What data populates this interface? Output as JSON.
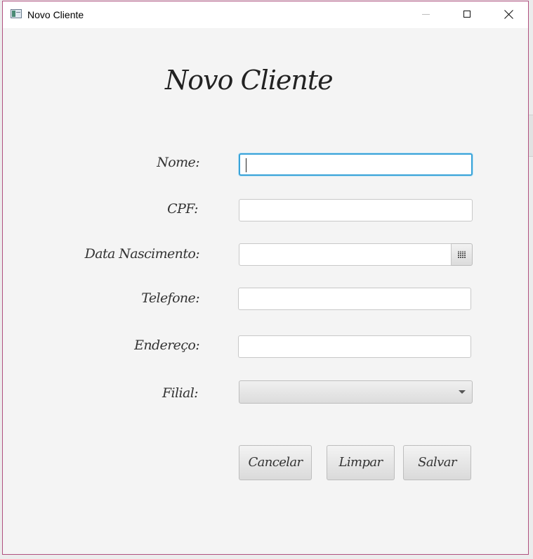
{
  "window": {
    "title": "Novo Cliente",
    "controls": [
      "minimize-icon",
      "maximize-icon",
      "close-icon"
    ]
  },
  "form": {
    "heading": "Novo Cliente",
    "fields": {
      "nome": {
        "label": "Nome:",
        "value": ""
      },
      "cpf": {
        "label": "CPF:",
        "value": ""
      },
      "data_nascimento": {
        "label": "Data Nascimento:",
        "value": "",
        "icon": "calendar-icon"
      },
      "telefone": {
        "label": "Telefone:",
        "value": ""
      },
      "endereco": {
        "label": "Endereço:",
        "value": ""
      },
      "filial": {
        "label": "Filial:",
        "selected": "",
        "icon": "chevron-down-icon"
      }
    },
    "buttons": {
      "cancel": "Cancelar",
      "clear": "Limpar",
      "save": "Salvar"
    }
  },
  "colors": {
    "focus": "#39a3d8",
    "window_border": "#b0507f",
    "background": "#f4f4f4"
  }
}
